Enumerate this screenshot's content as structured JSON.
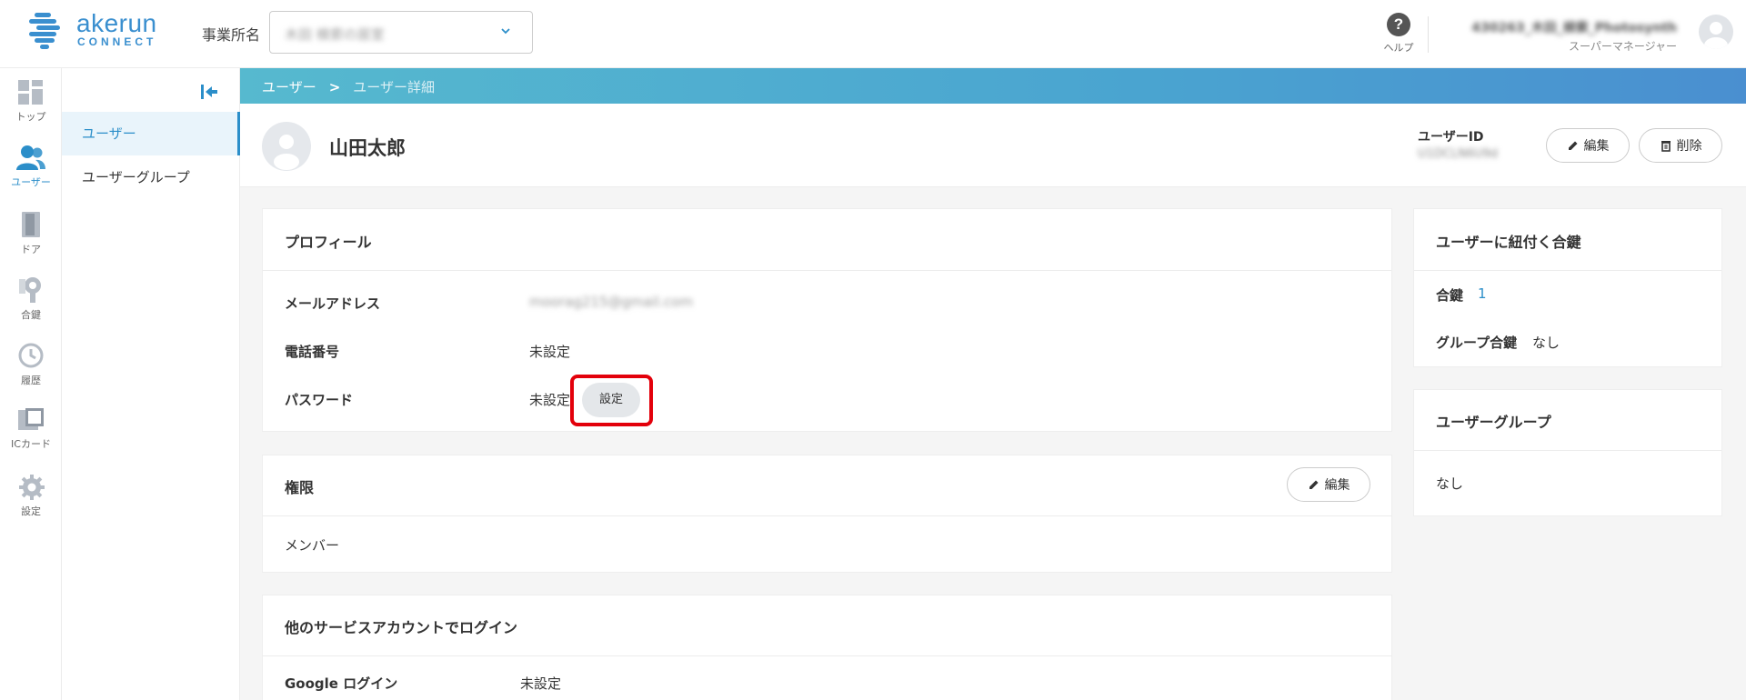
{
  "brand": {
    "name": "akerun",
    "sub": "CONNECT",
    "color": "#3a8fcf"
  },
  "header": {
    "office_label": "事業所名",
    "office_value": "木田 検索の居室",
    "help_label": "ヘルプ",
    "user_name": "430263_木田_検索_Photosynth",
    "user_role": "スーパーマネージャー"
  },
  "rail": [
    {
      "label": "トップ",
      "icon": "dashboard-icon"
    },
    {
      "label": "ユーザー",
      "icon": "users-icon",
      "active": true
    },
    {
      "label": "ドア",
      "icon": "door-icon"
    },
    {
      "label": "合鍵",
      "icon": "key-icon"
    },
    {
      "label": "履歴",
      "icon": "history-icon"
    },
    {
      "label": "ICカード",
      "icon": "ic-card-icon"
    },
    {
      "label": "設定",
      "icon": "gear-icon"
    }
  ],
  "subnav": {
    "items": [
      {
        "label": "ユーザー",
        "active": true
      },
      {
        "label": "ユーザーグループ"
      }
    ]
  },
  "breadcrumb": {
    "root": "ユーザー",
    "sep": ">",
    "current": "ユーザー詳細"
  },
  "user": {
    "name": "山田太郎",
    "id_label": "ユーザーID",
    "id_value": "U1DCLN6U9d",
    "edit_label": "編集",
    "delete_label": "削除"
  },
  "profile": {
    "title": "プロフィール",
    "email_label": "メールアドレス",
    "email_value": "moorag215@gmail.com",
    "phone_label": "電話番号",
    "phone_value": "未設定",
    "password_label": "パスワード",
    "password_value": "未設定",
    "password_set_button": "設定"
  },
  "permission": {
    "title": "権限",
    "edit_label": "編集",
    "value": "メンバー"
  },
  "other_login": {
    "title": "他のサービスアカウントでログイン",
    "google_label": "Google ログイン",
    "google_value": "未設定"
  },
  "keys": {
    "title": "ユーザーに紐付く合鍵",
    "key_label": "合鍵",
    "key_count": "1",
    "group_key_label": "グループ合鍵",
    "group_key_value": "なし"
  },
  "user_group": {
    "title": "ユーザーグループ",
    "value": "なし"
  },
  "colors": {
    "accent": "#2b8ec9",
    "highlight": "#e3000b"
  }
}
